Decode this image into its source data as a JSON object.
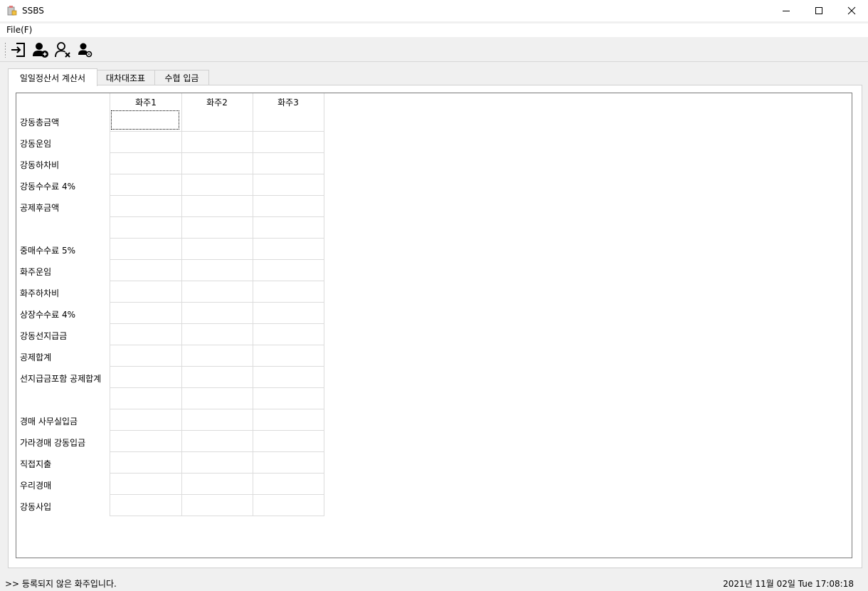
{
  "window": {
    "title": "SSBS"
  },
  "menu": {
    "file": "File(F)"
  },
  "toolbar": {
    "buttons": [
      {
        "icon": "login-icon"
      },
      {
        "icon": "add-user-icon"
      },
      {
        "icon": "remove-user-icon"
      },
      {
        "icon": "user-settings-icon"
      }
    ]
  },
  "tabs": [
    {
      "label": "일일정산서 계산서",
      "active": true
    },
    {
      "label": "대차대조표",
      "active": false
    },
    {
      "label": "수협 입금",
      "active": false
    }
  ],
  "grid": {
    "columns": [
      "화주1",
      "화주2",
      "화주3"
    ],
    "rows": [
      "강동총금액",
      "강동운임",
      "강동하차비",
      "강동수수료 4%",
      "공제후금액",
      "",
      "중매수수료 5%",
      "화주운임",
      "화주하차비",
      "상장수수료 4%",
      "강동선지급금",
      "공제합계",
      "선지급금포함 공제합계",
      "",
      "경매 사무실입금",
      "가라경매 강동입금",
      "직접지출",
      "우리경매",
      "강동사입"
    ]
  },
  "status": {
    "message": ">> 등록되지 않은 화주입니다.",
    "datetime": "2021년 11월 02일 Tue 17:08:18"
  }
}
